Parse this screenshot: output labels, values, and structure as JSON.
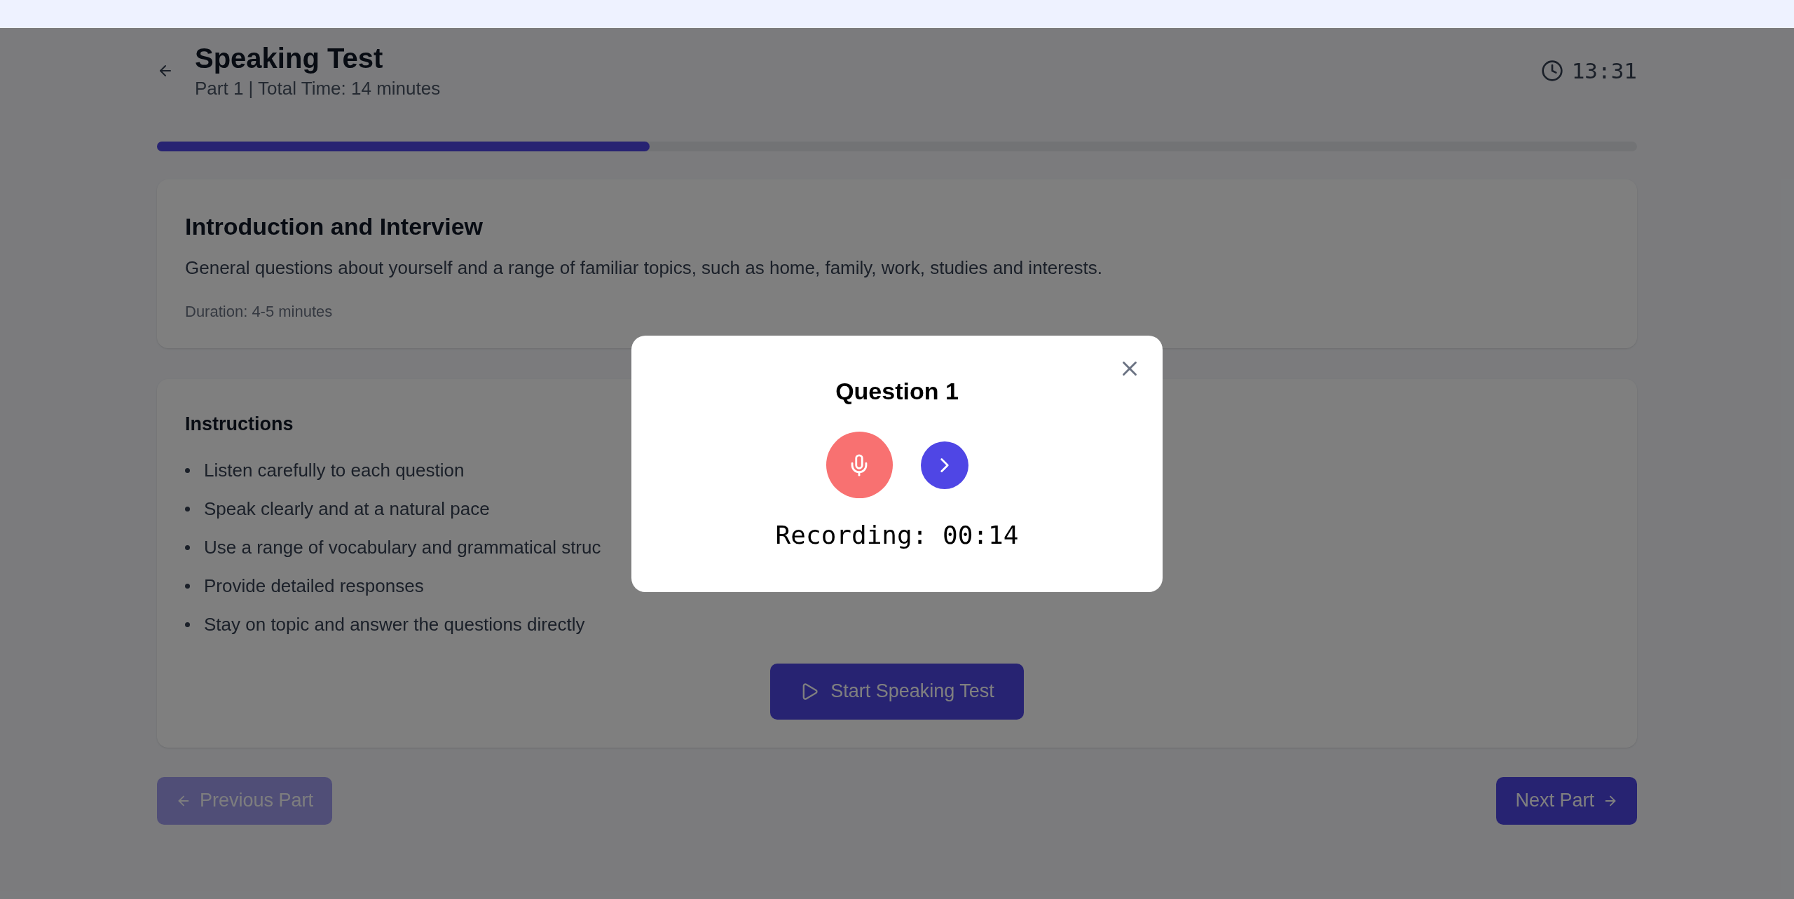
{
  "header": {
    "title": "Speaking Test",
    "subtitle": "Part 1 | Total Time: 14 minutes",
    "timer": "13:31"
  },
  "progress": {
    "level": 0.333
  },
  "part": {
    "title": "Introduction and Interview",
    "description": "General questions about yourself and a range of familiar topics, such as home, family, work, studies and interests.",
    "duration": "Duration: 4-5 minutes"
  },
  "instructions": {
    "title": "Instructions",
    "items": [
      "Listen carefully to each question",
      "Speak clearly and at a natural pace",
      "Use a range of vocabulary and grammatical struc",
      "Provide detailed responses",
      "Stay on topic and answer the questions directly"
    ],
    "start_button": "Start Speaking Test"
  },
  "navigation": {
    "previous": {
      "label": "Previous Part",
      "disabled": true
    },
    "next": {
      "label": "Next Part",
      "disabled": false
    }
  },
  "modal": {
    "title": "Question 1",
    "recording": true,
    "status": "Recording: 00:14"
  }
}
